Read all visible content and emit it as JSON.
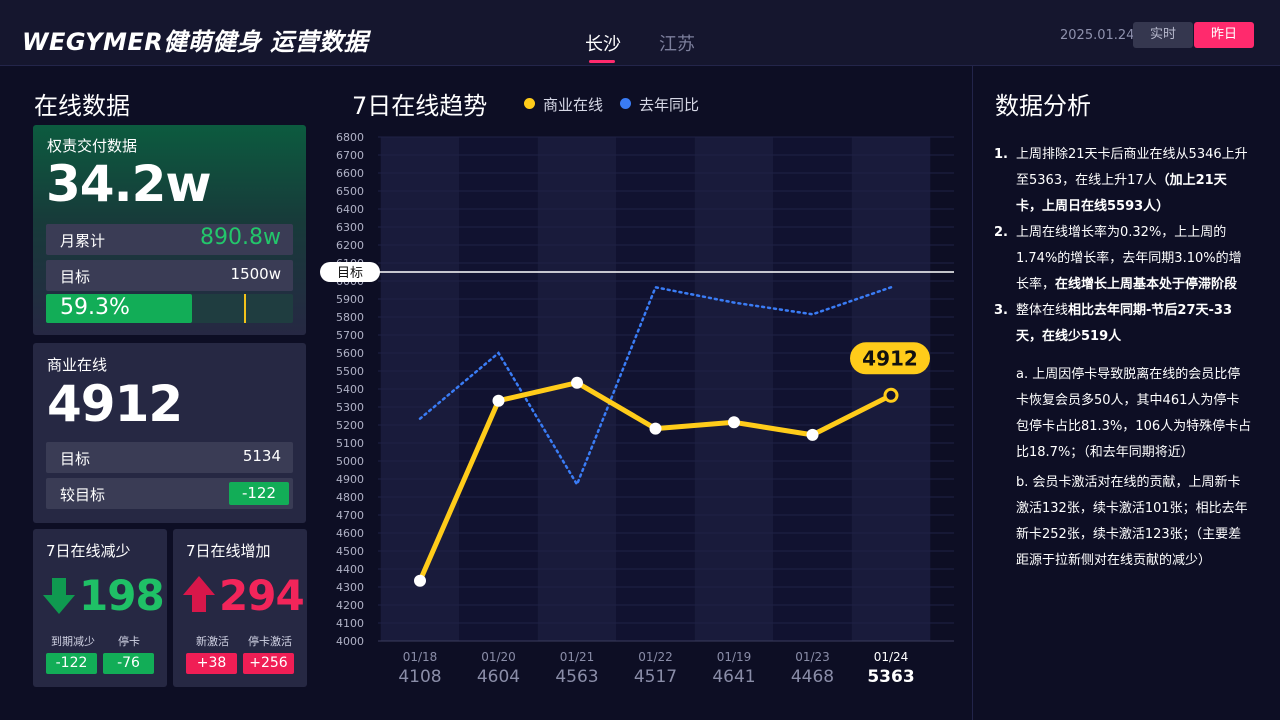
{
  "header": {
    "logo": "WEGYMER健萌健身 运营数据",
    "cities": [
      "长沙",
      "江苏"
    ],
    "date": "2025.01.24",
    "btn_realtime": "实时",
    "btn_yesterday": "昨日"
  },
  "online": {
    "section_title": "在线数据",
    "rights": {
      "label": "权责交付数据",
      "value": "34.2w",
      "month_label": "月累计",
      "month_value": "890.8w",
      "target_label": "目标",
      "target_value": "1500w",
      "progress_text": "59.3%",
      "progress": 0.593
    },
    "commercial": {
      "label": "商业在线",
      "value": "4912",
      "target_label": "目标",
      "target_value": "5134",
      "vs_label": "较目标",
      "vs_value": "-122"
    },
    "decrease": {
      "title": "7日在线减少",
      "value": "198",
      "lab1": "到期减少",
      "val1": "-122",
      "lab2": "停卡",
      "val2": "-76"
    },
    "increase": {
      "title": "7日在线增加",
      "value": "294",
      "lab1": "新激活",
      "val1": "+38",
      "lab2": "停卡激活",
      "val2": "+256"
    }
  },
  "colors": {
    "commercial": "#ffcc1a",
    "last_year": "#3a7cf5",
    "accent": "#ff2a6d",
    "green": "#12ad57",
    "red": "#f01e55"
  },
  "chart_data": {
    "type": "line",
    "title": "7日在线趋势",
    "ylim": [
      4000,
      6800
    ],
    "ytick_step": 100,
    "target": 6050,
    "target_label": "目标",
    "callout": "4912",
    "categories": [
      "01/18",
      "01/20",
      "01/21",
      "01/22",
      "01/19",
      "01/23",
      "01/24"
    ],
    "bottom_values": [
      "4108",
      "4604",
      "4563",
      "4517",
      "4641",
      "4468",
      "5363"
    ],
    "series": [
      {
        "name": "商业在线",
        "style": "solid",
        "values": [
          4335,
          5335,
          5435,
          5180,
          5215,
          5145,
          5365
        ]
      },
      {
        "name": "去年同比",
        "style": "dotted",
        "values": [
          5235,
          5600,
          4870,
          5965,
          5880,
          5815,
          5965
        ]
      }
    ]
  },
  "analysis": {
    "title": "数据分析",
    "p1_num": "1.",
    "p1_text": "上周排除21天卡后商业在线从5346上升至5363，在线上升17人",
    "p1_bold": "（加上21天卡，上周日在线5593人）",
    "p2_num": "2.",
    "p2_text": "上周在线增长率为0.32%，上上周的1.74%的增长率，去年同期3.10%的增长率，",
    "p2_bold": "在线增长上周基本处于停滞阶段",
    "p3_num": "3.",
    "p3_text": "整体在线",
    "p3_bold": "相比去年同期-节后27天-33天，在线少519人",
    "p3a": "a. 上周因停卡导致脱离在线的会员比停卡恢复会员多50人，其中461人为停卡包停卡占比81.3%，106人为特殊停卡占比18.7%；（和去年同期将近）",
    "p3b": "b. 会员卡激活对在线的贡献，上周新卡激活132张，续卡激活101张；相比去年新卡252张，续卡激活123张；（主要差距源于拉新侧对在线贡献的减少）"
  }
}
